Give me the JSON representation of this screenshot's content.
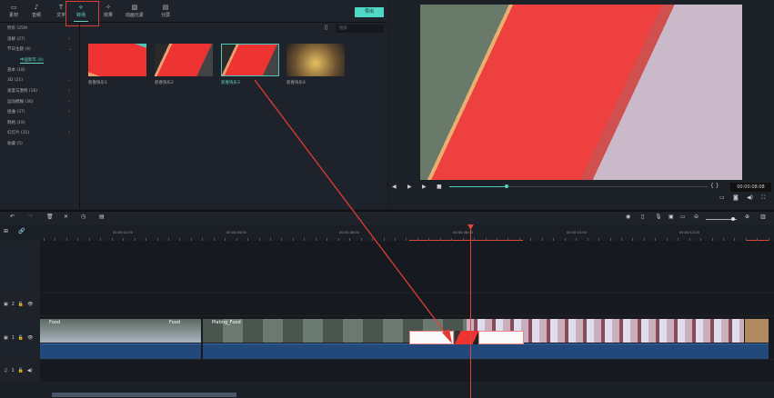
{
  "tabs": [
    {
      "label": "素材",
      "icon": "folder-icon"
    },
    {
      "label": "音频",
      "icon": "music-icon"
    },
    {
      "label": "文字",
      "icon": "text-icon"
    },
    {
      "label": "转场",
      "icon": "transition-icon",
      "active": true
    },
    {
      "label": "效果",
      "icon": "effects-icon"
    },
    {
      "label": "动画元素",
      "icon": "image-icon"
    },
    {
      "label": "分屏",
      "icon": "split-screen-icon"
    }
  ],
  "export_label": "导出",
  "search_placeholder": "搜索",
  "sidebar": [
    {
      "label": "所有 (259)"
    },
    {
      "label": "溶解 (27)",
      "chev": ">"
    },
    {
      "label": "节日主题 (4)",
      "chev": "v"
    },
    {
      "label": "中国新年 (4)",
      "sub": true
    },
    {
      "label": "基本 (18)"
    },
    {
      "label": "3D (21)",
      "chev": ">"
    },
    {
      "label": "速度与激情 (16)",
      "chev": ">"
    },
    {
      "label": "运动模糊 (36)",
      "chev": ">"
    },
    {
      "label": "扭曲 (37)",
      "chev": ">"
    },
    {
      "label": "网格 (19)"
    },
    {
      "label": "幻灯片 (31)",
      "chev": ">"
    },
    {
      "label": "收藏 (5)"
    }
  ],
  "thumbnails": [
    {
      "label": "新春快乐1"
    },
    {
      "label": "新春快乐2"
    },
    {
      "label": "新春快乐3",
      "selected": true
    },
    {
      "label": "新春快乐4"
    }
  ],
  "preview": {
    "timecode": "00:00:08:08",
    "progress_fraction": 0.22
  },
  "ruler": [
    "00:00:02:00",
    "00:00:04:00",
    "00:00:06:00",
    "00:00:08:00",
    "00:00:10:00",
    "00:00:12:00"
  ],
  "tracks": {
    "t2": "2",
    "t1": "1",
    "a1": "1"
  },
  "clips": {
    "food1": "Food",
    "food2": "Food",
    "plating": "Plating_Food"
  },
  "colors": {
    "accent": "#4fd8c4",
    "playhead": "#e0453a",
    "annotation": "#e23c32"
  }
}
